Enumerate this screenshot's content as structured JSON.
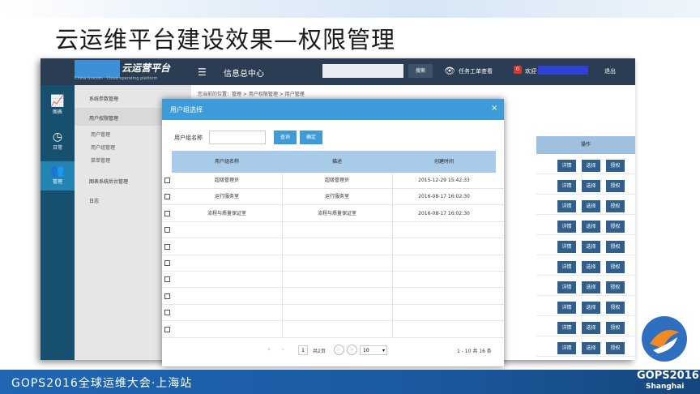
{
  "slide": {
    "title": "云运维平台建设效果—权限管理",
    "footer_text": "GOPS2016全球运维大会·上海站",
    "footer_logo": "GOPS2016",
    "footer_logo_sub": "Shanghai"
  },
  "header": {
    "logo_text": "云运营平台",
    "logo_sub": "China Unicom · Cloud operating platform",
    "info_center": "信息总中心",
    "search_button": "搜索",
    "ticket_link": "任务工单查看",
    "user_badge": "G",
    "welcome": "欢迎",
    "logout": "退出"
  },
  "leftbar": [
    {
      "label": "图表",
      "icon": "chart-icon"
    },
    {
      "label": "日常",
      "icon": "clock-icon"
    },
    {
      "label": "管理",
      "icon": "users-icon"
    }
  ],
  "sidemenu": {
    "system_params": "系统参数管理",
    "user_permission": "用户权限管理",
    "user_mgmt": "用户管理",
    "user_group_mgmt": "用户组管理",
    "menu_mgmt": "菜单管理",
    "backend_mgmt": "图表系统后台管理",
    "log": "日志"
  },
  "content": {
    "breadcrumb": "您当前的位置：管理 > 用户权限管理 > 用户管理",
    "ops_header": "操作",
    "op_labels": {
      "detail": "详情",
      "select": "选择",
      "grant": "授权"
    }
  },
  "modal": {
    "title": "用户组选择",
    "close": "×",
    "filter_label": "用户组名称",
    "query_button": "查询",
    "confirm_button": "确定",
    "columns": [
      "用户组名称",
      "描述",
      "创建时间"
    ],
    "rows": [
      {
        "name": "超级管理员",
        "desc": "超级管理员",
        "created": "2015-12-29 15:42:33"
      },
      {
        "name": "运行服务室",
        "desc": "运行服务室",
        "created": "2016-08-17 16:02:30"
      },
      {
        "name": "流程与质量保证室",
        "desc": "流程与质量保证室",
        "created": "2016-08-17 16:02:30"
      }
    ],
    "pager": {
      "page_current": "1",
      "page_total": "共2页",
      "page_size": "10",
      "range": "1 - 10  共 16 条"
    }
  }
}
